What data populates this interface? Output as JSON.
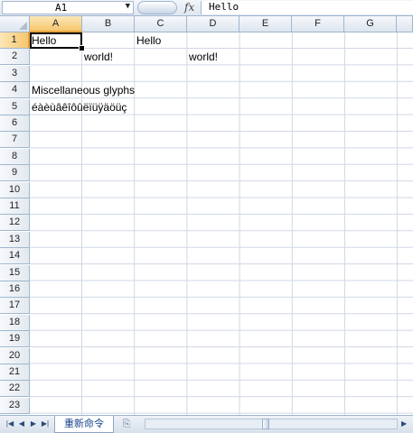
{
  "formula_bar": {
    "name_box": "A1",
    "fx_label": "fx",
    "value": "Hello"
  },
  "columns": [
    "A",
    "B",
    "C",
    "D",
    "E",
    "F",
    "G"
  ],
  "rows": [
    "1",
    "2",
    "3",
    "4",
    "5",
    "6",
    "7",
    "8",
    "9",
    "10",
    "11",
    "12",
    "13",
    "14",
    "15",
    "16",
    "17",
    "18",
    "19",
    "20",
    "21",
    "22",
    "23"
  ],
  "cells": {
    "A1": "Hello",
    "C1": "Hello",
    "B2": "world!",
    "D2": "world!",
    "A4": "Miscellaneous glyphs",
    "A5": "éàèùâêîôûëïüÿäöüç"
  },
  "sheet_tabs": [
    "重新命令"
  ],
  "colors": {
    "selected_header": "#f7c66e",
    "header_border": "#9eb6ce",
    "grid_line": "#d0d7e5"
  }
}
